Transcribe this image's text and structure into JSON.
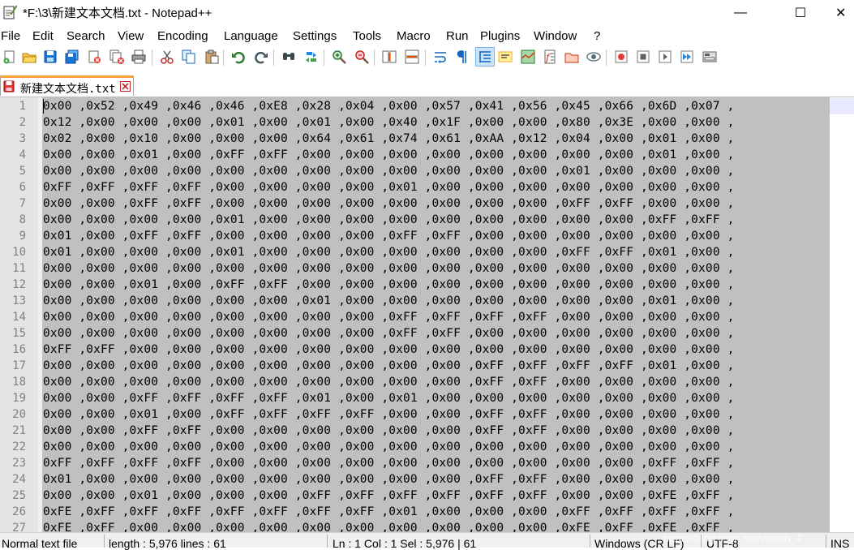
{
  "window": {
    "title": "*F:\\3\\新建文本文档.txt - Notepad++",
    "minimize_glyph": "—",
    "maximize_glyph": "☐",
    "close_glyph": "✕"
  },
  "menu": [
    {
      "label": "File",
      "name": "menu-file"
    },
    {
      "label": "Edit",
      "name": "menu-edit"
    },
    {
      "label": "Search",
      "name": "menu-search"
    },
    {
      "label": "View",
      "name": "menu-view"
    },
    {
      "label": "Encoding",
      "name": "menu-encoding"
    },
    {
      "label": "Language",
      "name": "menu-language"
    },
    {
      "label": "Settings",
      "name": "menu-settings"
    },
    {
      "label": "Tools",
      "name": "menu-tools"
    },
    {
      "label": "Macro",
      "name": "menu-macro"
    },
    {
      "label": "Run",
      "name": "menu-run"
    },
    {
      "label": "Plugins",
      "name": "menu-plugins"
    },
    {
      "label": "Window",
      "name": "menu-window"
    },
    {
      "label": "?",
      "name": "menu-help"
    }
  ],
  "toolbar_icons": [
    "new-file-icon",
    "open-file-icon",
    "save-icon",
    "save-all-icon",
    "close-icon",
    "close-all-icon",
    "print-icon",
    "cut-icon",
    "copy-icon",
    "paste-icon",
    "undo-icon",
    "redo-icon",
    "find-icon",
    "replace-icon",
    "zoom-in-icon",
    "zoom-out-icon",
    "sync-vertical-icon",
    "sync-horizontal-icon",
    "word-wrap-icon",
    "show-all-characters-icon",
    "indent-guide-icon",
    "user-defined-language-icon",
    "document-map-icon",
    "function-list-icon",
    "folder-as-workspace-icon",
    "monitoring-icon",
    "record-macro-icon",
    "stop-recording-icon",
    "playback-macro-icon",
    "run-macro-multiple-icon",
    "save-macro-icon"
  ],
  "colors": {
    "tab_accent": "#f9a23c",
    "selection": "#c0c0c0",
    "gutter": "#e4e4e4",
    "line_number": "#808080"
  },
  "tab": {
    "label": "新建文本文档.txt",
    "icon": "unsaved-file-icon",
    "close_icon": "tab-close-icon"
  },
  "editor": {
    "line_numbers": [
      "1",
      "2",
      "3",
      "4",
      "5",
      "6",
      "7",
      "8",
      "9",
      "10",
      "11",
      "12",
      "13",
      "14",
      "15",
      "16",
      "17",
      "18",
      "19",
      "20",
      "21",
      "22",
      "23",
      "24",
      "25",
      "26",
      "27"
    ],
    "lines": [
      "0x00 ,0x52 ,0x49 ,0x46 ,0x46 ,0xE8 ,0x28 ,0x04 ,0x00 ,0x57 ,0x41 ,0x56 ,0x45 ,0x66 ,0x6D ,0x07 ,",
      "0x12 ,0x00 ,0x00 ,0x00 ,0x01 ,0x00 ,0x01 ,0x00 ,0x40 ,0x1F ,0x00 ,0x00 ,0x80 ,0x3E ,0x00 ,0x00 ,",
      "0x02 ,0x00 ,0x10 ,0x00 ,0x00 ,0x00 ,0x64 ,0x61 ,0x74 ,0x61 ,0xAA ,0x12 ,0x04 ,0x00 ,0x01 ,0x00 ,",
      "0x00 ,0x00 ,0x01 ,0x00 ,0xFF ,0xFF ,0x00 ,0x00 ,0x00 ,0x00 ,0x00 ,0x00 ,0x00 ,0x00 ,0x01 ,0x00 ,",
      "0x00 ,0x00 ,0x00 ,0x00 ,0x00 ,0x00 ,0x00 ,0x00 ,0x00 ,0x00 ,0x00 ,0x00 ,0x01 ,0x00 ,0x00 ,0x00 ,",
      "0xFF ,0xFF ,0xFF ,0xFF ,0x00 ,0x00 ,0x00 ,0x00 ,0x01 ,0x00 ,0x00 ,0x00 ,0x00 ,0x00 ,0x00 ,0x00 ,",
      "0x00 ,0x00 ,0xFF ,0xFF ,0x00 ,0x00 ,0x00 ,0x00 ,0x00 ,0x00 ,0x00 ,0x00 ,0xFF ,0xFF ,0x00 ,0x00 ,",
      "0x00 ,0x00 ,0x00 ,0x00 ,0x01 ,0x00 ,0x00 ,0x00 ,0x00 ,0x00 ,0x00 ,0x00 ,0x00 ,0x00 ,0xFF ,0xFF ,",
      "0x01 ,0x00 ,0xFF ,0xFF ,0x00 ,0x00 ,0x00 ,0x00 ,0xFF ,0xFF ,0x00 ,0x00 ,0x00 ,0x00 ,0x00 ,0x00 ,",
      "0x01 ,0x00 ,0x00 ,0x00 ,0x01 ,0x00 ,0x00 ,0x00 ,0x00 ,0x00 ,0x00 ,0x00 ,0xFF ,0xFF ,0x01 ,0x00 ,",
      "0x00 ,0x00 ,0x00 ,0x00 ,0x00 ,0x00 ,0x00 ,0x00 ,0x00 ,0x00 ,0x00 ,0x00 ,0x00 ,0x00 ,0x00 ,0x00 ,",
      "0x00 ,0x00 ,0x01 ,0x00 ,0xFF ,0xFF ,0x00 ,0x00 ,0x00 ,0x00 ,0x00 ,0x00 ,0x00 ,0x00 ,0x00 ,0x00 ,",
      "0x00 ,0x00 ,0x00 ,0x00 ,0x00 ,0x00 ,0x01 ,0x00 ,0x00 ,0x00 ,0x00 ,0x00 ,0x00 ,0x00 ,0x01 ,0x00 ,",
      "0x00 ,0x00 ,0x00 ,0x00 ,0x00 ,0x00 ,0x00 ,0x00 ,0xFF ,0xFF ,0xFF ,0xFF ,0x00 ,0x00 ,0x00 ,0x00 ,",
      "0x00 ,0x00 ,0x00 ,0x00 ,0x00 ,0x00 ,0x00 ,0x00 ,0xFF ,0xFF ,0x00 ,0x00 ,0x00 ,0x00 ,0x00 ,0x00 ,",
      "0xFF ,0xFF ,0x00 ,0x00 ,0x00 ,0x00 ,0x00 ,0x00 ,0x00 ,0x00 ,0x00 ,0x00 ,0x00 ,0x00 ,0x00 ,0x00 ,",
      "0x00 ,0x00 ,0x00 ,0x00 ,0x00 ,0x00 ,0x00 ,0x00 ,0x00 ,0x00 ,0xFF ,0xFF ,0xFF ,0xFF ,0x01 ,0x00 ,",
      "0x00 ,0x00 ,0x00 ,0x00 ,0x00 ,0x00 ,0x00 ,0x00 ,0x00 ,0x00 ,0xFF ,0xFF ,0x00 ,0x00 ,0x00 ,0x00 ,",
      "0x00 ,0x00 ,0xFF ,0xFF ,0xFF ,0xFF ,0x01 ,0x00 ,0x01 ,0x00 ,0x00 ,0x00 ,0x00 ,0x00 ,0x00 ,0x00 ,",
      "0x00 ,0x00 ,0x01 ,0x00 ,0xFF ,0xFF ,0xFF ,0xFF ,0x00 ,0x00 ,0xFF ,0xFF ,0x00 ,0x00 ,0x00 ,0x00 ,",
      "0x00 ,0x00 ,0xFF ,0xFF ,0x00 ,0x00 ,0x00 ,0x00 ,0x00 ,0x00 ,0xFF ,0xFF ,0x00 ,0x00 ,0x00 ,0x00 ,",
      "0x00 ,0x00 ,0x00 ,0x00 ,0x00 ,0x00 ,0x00 ,0x00 ,0x00 ,0x00 ,0x00 ,0x00 ,0x00 ,0x00 ,0x00 ,0x00 ,",
      "0xFF ,0xFF ,0xFF ,0xFF ,0x00 ,0x00 ,0x00 ,0x00 ,0x00 ,0x00 ,0x00 ,0x00 ,0x00 ,0x00 ,0xFF ,0xFF ,",
      "0x01 ,0x00 ,0x00 ,0x00 ,0x00 ,0x00 ,0x00 ,0x00 ,0x00 ,0x00 ,0xFF ,0xFF ,0x00 ,0x00 ,0x00 ,0x00 ,",
      "0x00 ,0x00 ,0x01 ,0x00 ,0x00 ,0x00 ,0xFF ,0xFF ,0xFF ,0xFF ,0xFF ,0xFF ,0x00 ,0x00 ,0xFE ,0xFF ,",
      "0xFE ,0xFF ,0xFF ,0xFF ,0xFF ,0xFF ,0xFF ,0xFF ,0x01 ,0x00 ,0x00 ,0x00 ,0xFF ,0xFF ,0xFF ,0xFF ,",
      "0xFE ,0xFF ,0x00 ,0x00 ,0x00 ,0x00 ,0x00 ,0x00 ,0x00 ,0x00 ,0x00 ,0x00 ,0xFE ,0xFF ,0xFE ,0xFF ,"
    ]
  },
  "status": {
    "file_type": "Normal text file",
    "length_lines": "length : 5,976    lines : 61",
    "position": "Ln : 1    Col : 1    Sel : 5,976 | 61",
    "eol": "Windows (CR LF)",
    "encoding": "UTF-8",
    "mode": "INS"
  },
  "watermark": "https://blog.csdn.net/weixin_4"
}
